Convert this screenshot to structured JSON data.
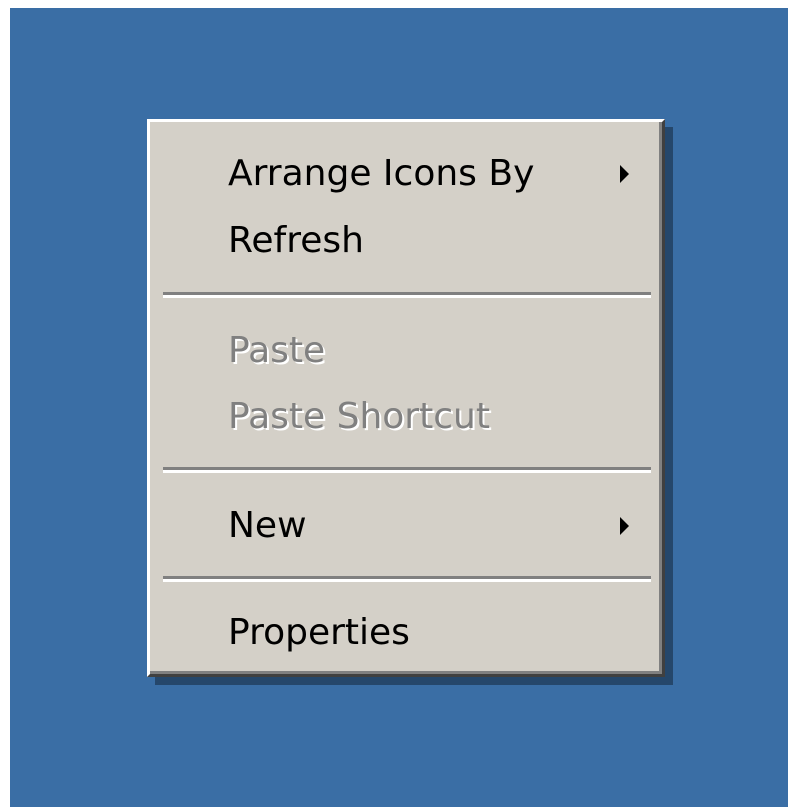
{
  "context_menu": {
    "items": [
      {
        "label": "Arrange Icons By",
        "enabled": true,
        "submenu": true
      },
      {
        "label": "Refresh",
        "enabled": true,
        "submenu": false
      },
      {
        "label": "Paste",
        "enabled": false,
        "submenu": false
      },
      {
        "label": "Paste Shortcut",
        "enabled": false,
        "submenu": false
      },
      {
        "label": "New",
        "enabled": true,
        "submenu": true
      },
      {
        "label": "Properties",
        "enabled": true,
        "submenu": false
      }
    ]
  },
  "colors": {
    "desktop": "#3a6ea5",
    "menu_face": "#d4d0c8",
    "disabled_text": "#808080"
  }
}
